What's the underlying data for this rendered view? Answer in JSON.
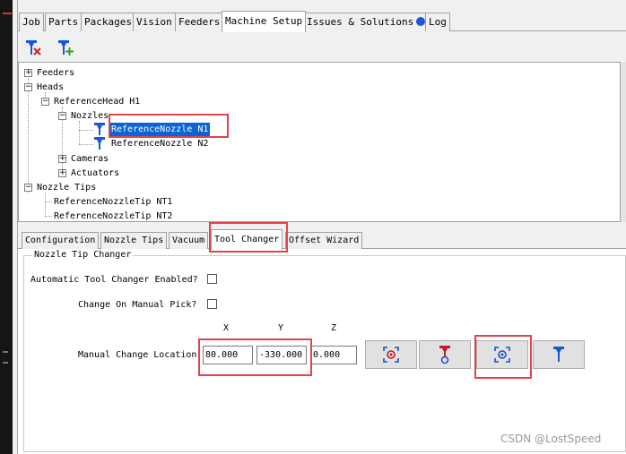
{
  "tabs": [
    "Job",
    "Parts",
    "Packages",
    "Vision",
    "Feeders",
    "Machine Setup",
    "Issues & Solutions",
    "Log"
  ],
  "toolbar": {
    "icons": [
      "nozzle-remove-icon",
      "nozzle-add-icon"
    ]
  },
  "tree": {
    "feeders": "Feeders",
    "heads": "Heads",
    "reference_head": "ReferenceHead H1",
    "nozzles": "Nozzles",
    "nozzle_n1": "ReferenceNozzle N1",
    "nozzle_n2": "ReferenceNozzle N2",
    "cameras": "Cameras",
    "actuators": "Actuators",
    "nozzle_tips": "Nozzle Tips",
    "tip_nt1": "ReferenceNozzleTip NT1",
    "tip_nt2": "ReferenceNozzleTip NT2",
    "expand_plus": "+",
    "expand_minus": "−"
  },
  "sub_tabs": [
    "Configuration",
    "Nozzle Tips",
    "Vacuum",
    "Tool Changer",
    "Offset Wizard"
  ],
  "tool_changer": {
    "group_title": "Nozzle Tip Changer",
    "auto_enabled_label": "Automatic Tool Changer Enabled?",
    "manual_pick_label": "Change On Manual Pick?",
    "axis_x": "X",
    "axis_y": "Y",
    "axis_z": "Z",
    "manual_location_label": "Manual Change Location",
    "x_value": "80.000",
    "y_value": "-330.000",
    "z_value": "0.000"
  },
  "colors": {
    "selection": "#0a64d2",
    "highlight": "#e0434a",
    "icon_blue": "#1a57d6",
    "icon_red": "#c41a2f"
  },
  "watermark": "CSDN @LostSpeed"
}
